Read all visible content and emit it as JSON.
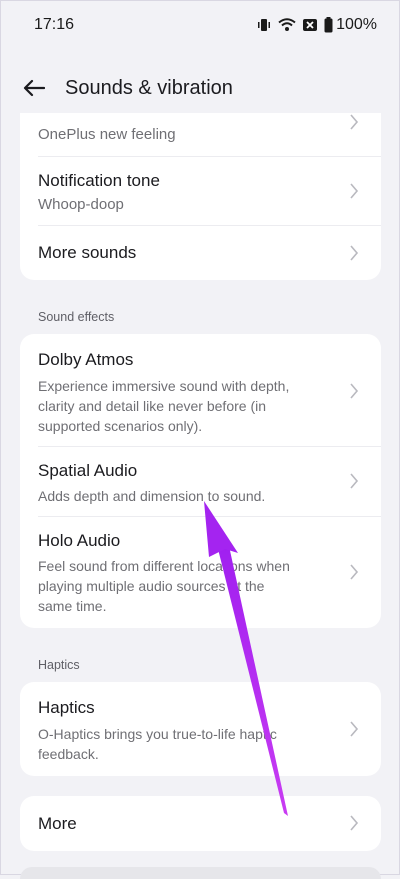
{
  "status": {
    "time": "17:16",
    "battery": "100%"
  },
  "header": {
    "title": "Sounds & vibration"
  },
  "top_card": {
    "partial_sub": "OnePlus new feeling",
    "items": [
      {
        "title": "Notification tone",
        "sub": "Whoop-doop"
      },
      {
        "title": "More sounds"
      }
    ]
  },
  "sound_effects": {
    "label": "Sound effects",
    "items": [
      {
        "title": "Dolby Atmos",
        "sub_lines": [
          "Experience immersive sound with depth,",
          "clarity and detail like never before (in",
          "supported scenarios only)."
        ]
      },
      {
        "title": "Spatial Audio",
        "sub_lines": [
          "Adds depth and dimension to sound."
        ]
      },
      {
        "title": "Holo Audio",
        "sub_lines": [
          "Feel sound from different locations when",
          "playing multiple audio sources at the",
          "same time."
        ]
      }
    ]
  },
  "haptics": {
    "label": "Haptics",
    "item": {
      "title": "Haptics",
      "sub_lines": [
        "O-Haptics brings you true-to-life haptic",
        "feedback."
      ]
    }
  },
  "more": {
    "title": "More"
  },
  "colors": {
    "background": "#f2f2f6",
    "card": "#ffffff",
    "annotation_arrow": "#b338f5"
  }
}
